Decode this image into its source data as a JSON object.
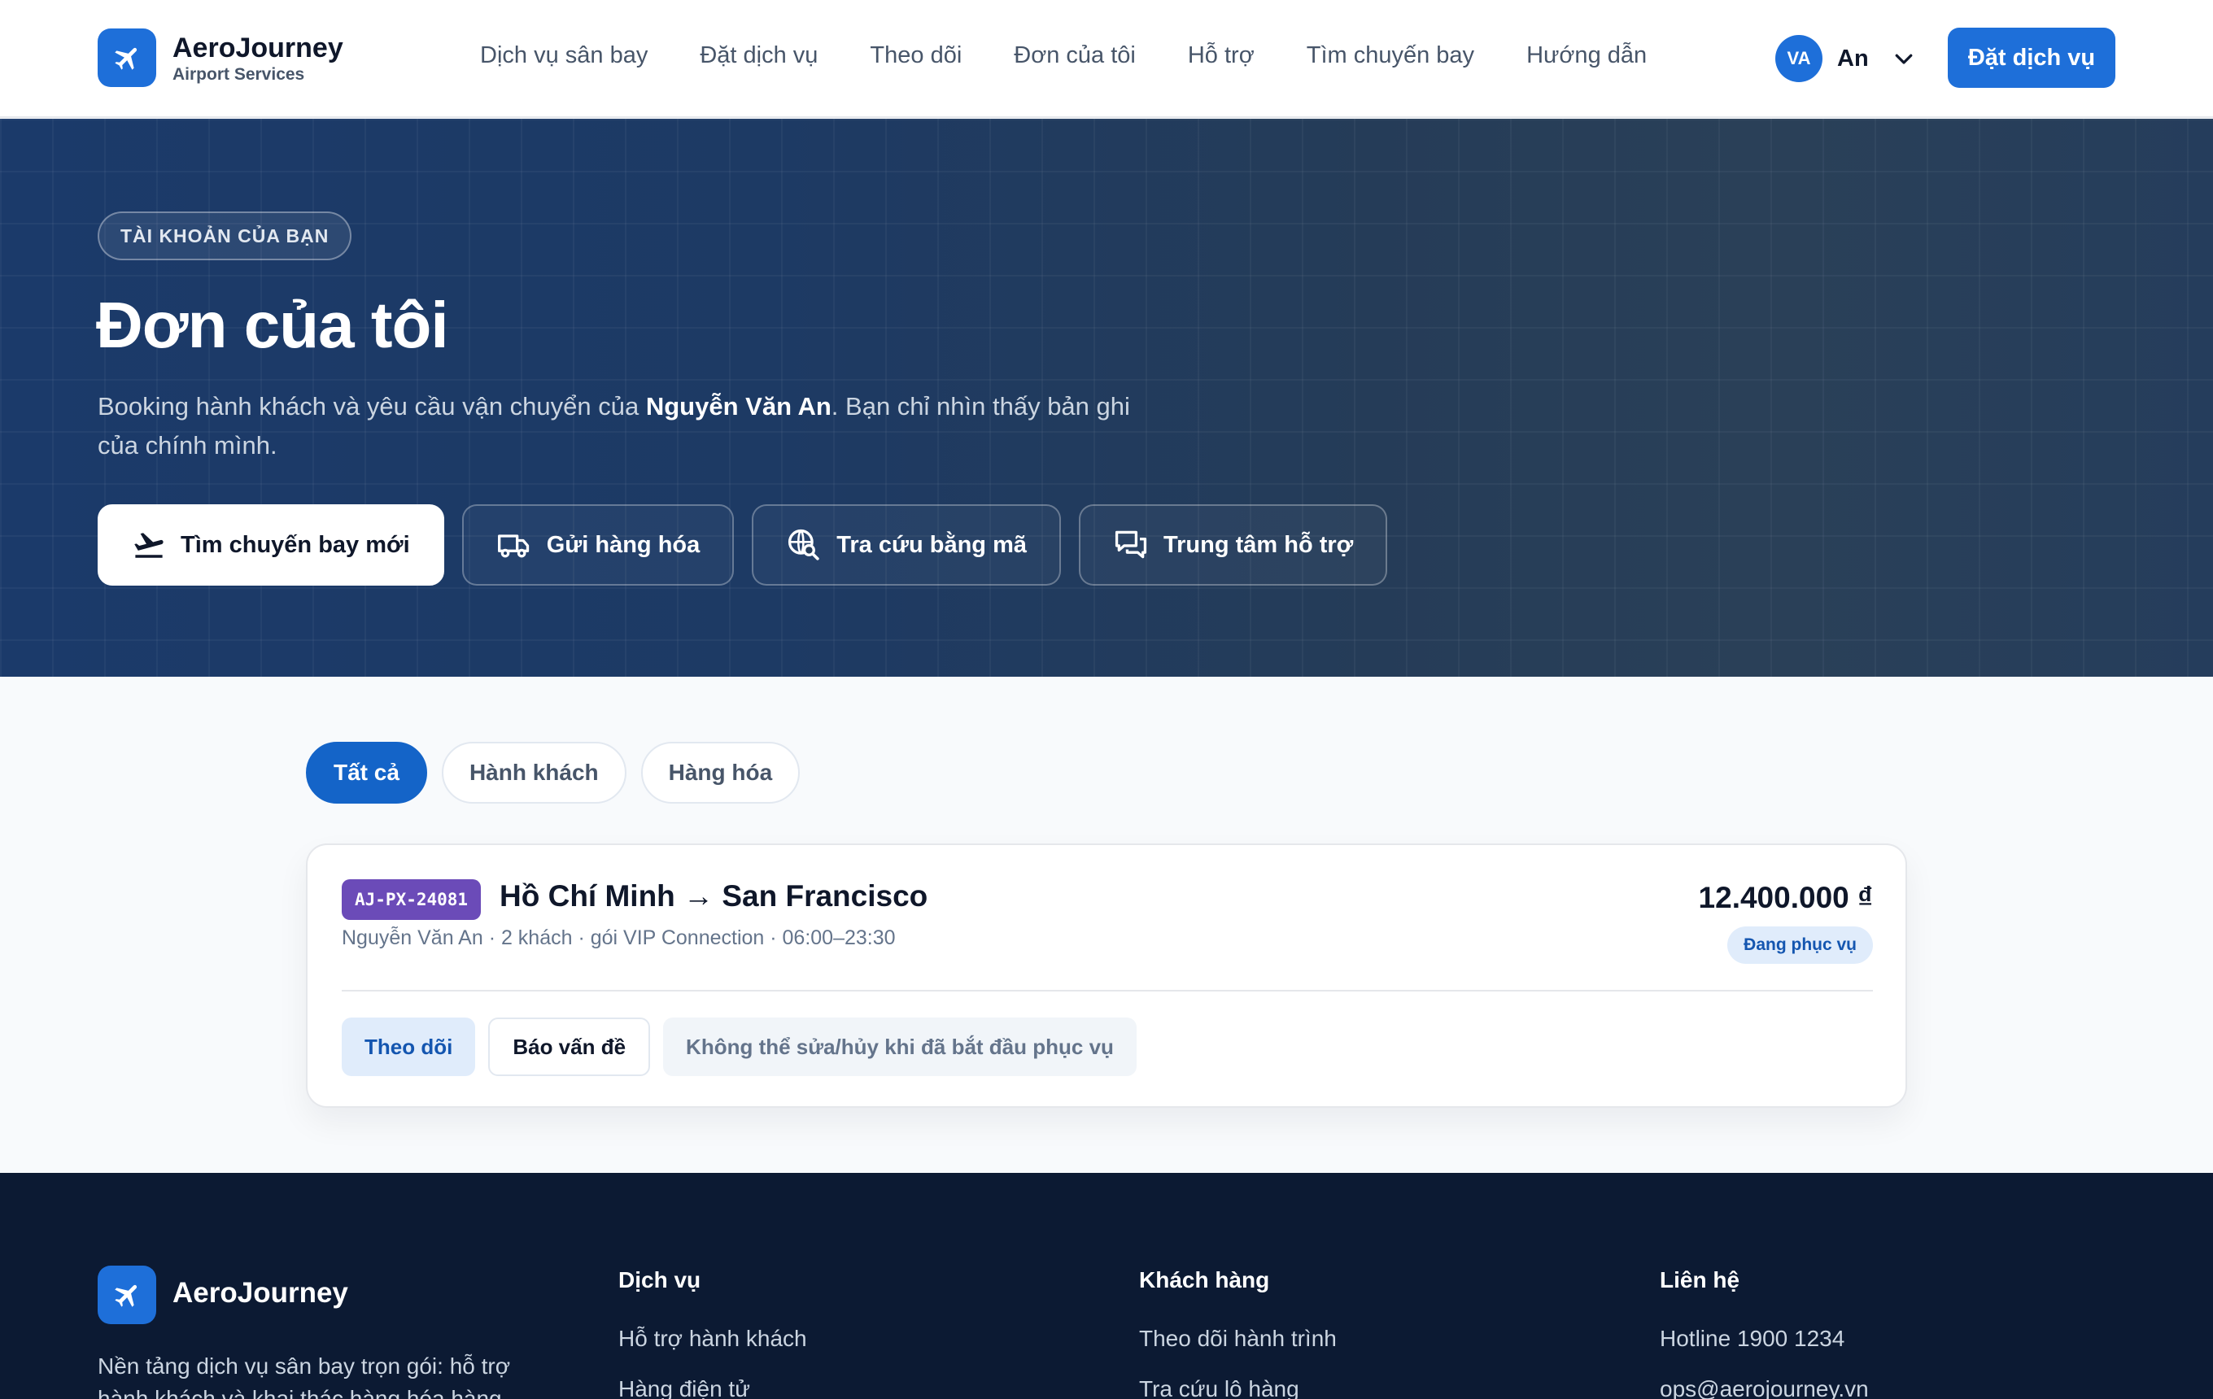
{
  "header": {
    "brand_name": "AeroJourney",
    "brand_sub": "Airport Services",
    "nav": [
      "Dịch vụ sân bay",
      "Đặt dịch vụ",
      "Theo dõi",
      "Đơn của tôi",
      "Hỗ trợ",
      "Tìm chuyến bay",
      "Hướng dẫn"
    ],
    "user_initials": "VA",
    "user_name": "An",
    "cta_label": "Đặt dịch vụ"
  },
  "hero": {
    "eyebrow": "TÀI KHOẢN CỦA BẠN",
    "title": "Đơn của tôi",
    "desc_before": "Booking hành khách và yêu cầu vận chuyển của ",
    "desc_name": "Nguyễn Văn An",
    "desc_after": ". Bạn chỉ nhìn thấy bản ghi của chính mình.",
    "actions": {
      "new_flight": "Tìm chuyến bay mới",
      "send_cargo": "Gửi hàng hóa",
      "lookup": "Tra cứu bằng mã",
      "support": "Trung tâm hỗ trợ"
    }
  },
  "filters": {
    "all": "Tất cả",
    "passenger": "Hành khách",
    "cargo": "Hàng hóa",
    "active": "all"
  },
  "order": {
    "code": "AJ-PX-24081",
    "route": "Hồ Chí Minh → San Francisco",
    "meta": "Nguyễn Văn An · 2 khách · gói VIP Connection · 06:00–23:30",
    "price": "12.400.000 ₫",
    "status": "Đang phục vụ",
    "track_label": "Theo dõi",
    "report_label": "Báo vấn đề",
    "note": "Không thể sửa/hủy khi đã bắt đầu phục vụ"
  },
  "footer": {
    "brand": "AeroJourney",
    "desc": "Nền tảng dịch vụ sân bay trọn gói: hỗ trợ hành khách và khai thác hàng hóa hàng",
    "col1": {
      "title": "Dịch vụ",
      "links": [
        "Hỗ trợ hành khách",
        "Hàng điện tử"
      ]
    },
    "col2": {
      "title": "Khách hàng",
      "links": [
        "Theo dõi hành trình",
        "Tra cứu lô hàng"
      ]
    },
    "col3": {
      "title": "Liên hệ",
      "links": [
        "Hotline 1900 1234",
        "ops@aerojourney.vn"
      ]
    }
  },
  "colors": {
    "brand": "#1e6fd9",
    "hero_bg": "#1d3a64",
    "code_badge": "#6b4bb8",
    "footer_bg": "#0c1a33"
  }
}
